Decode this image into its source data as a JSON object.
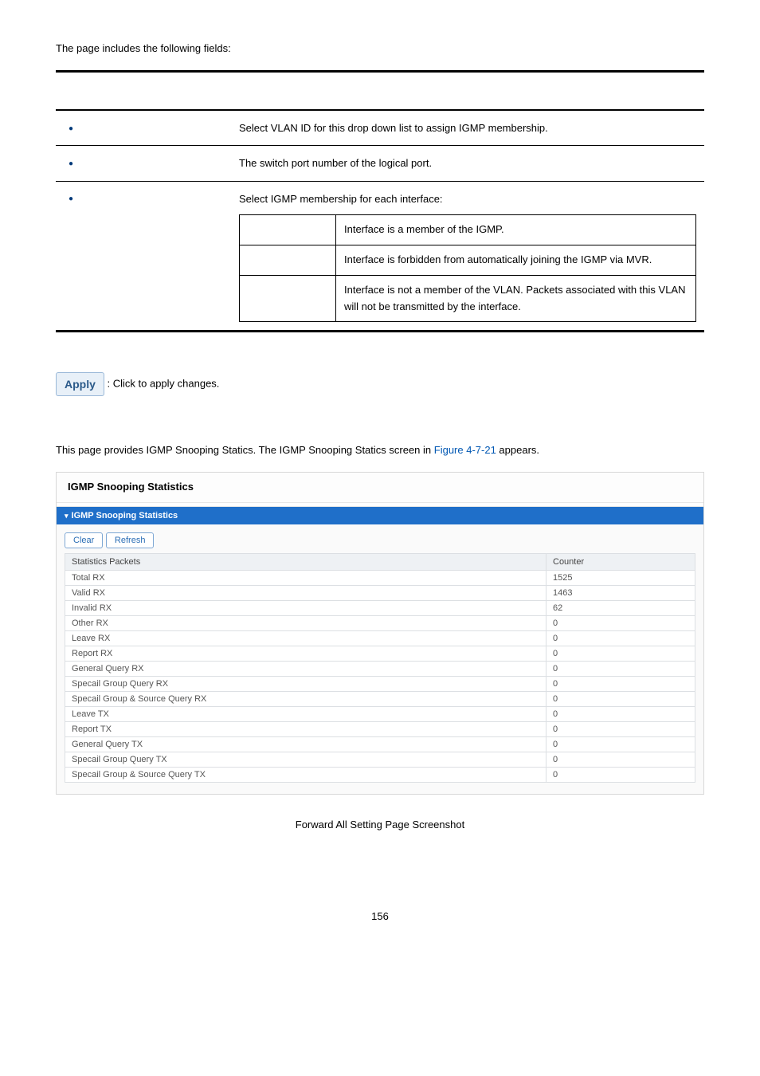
{
  "intro": "The page includes the following fields:",
  "field_table": {
    "header_obj": "",
    "header_desc": "",
    "rows": [
      {
        "obj": "",
        "desc": "Select VLAN ID for this drop down list to assign IGMP membership."
      },
      {
        "obj": "",
        "desc": "The switch port number of the logical port."
      },
      {
        "obj": "",
        "desc": "Select IGMP membership for each interface:"
      }
    ],
    "modes": [
      {
        "name": "",
        "desc": "Interface is a member of the IGMP."
      },
      {
        "name": "",
        "desc": "Interface is forbidden from automatically joining the IGMP via MVR."
      },
      {
        "name": "",
        "desc": "Interface is not a member of the VLAN. Packets associated with this VLAN will not be transmitted by the interface."
      }
    ]
  },
  "buttons": {
    "apply_label": "Apply",
    "apply_desc": ": Click to apply changes."
  },
  "section": {
    "desc_pre": "This page provides IGMP Snooping Statics. The IGMP Snooping Statics screen in ",
    "fig_ref": "Figure 4-7-21",
    "desc_post": " appears."
  },
  "panel": {
    "title": "IGMP Snooping Statistics",
    "sub_title": "IGMP Snooping Statistics",
    "clear": "Clear",
    "refresh": "Refresh",
    "col_packet": "Statistics Packets",
    "col_counter": "Counter",
    "rows": [
      {
        "name": "Total RX",
        "val": "1525"
      },
      {
        "name": "Valid RX",
        "val": "1463"
      },
      {
        "name": "Invalid RX",
        "val": "62"
      },
      {
        "name": "Other RX",
        "val": "0"
      },
      {
        "name": "Leave RX",
        "val": "0"
      },
      {
        "name": "Report RX",
        "val": "0"
      },
      {
        "name": "General Query RX",
        "val": "0"
      },
      {
        "name": "Specail Group Query RX",
        "val": "0"
      },
      {
        "name": "Specail Group & Source Query RX",
        "val": "0"
      },
      {
        "name": "Leave TX",
        "val": "0"
      },
      {
        "name": "Report TX",
        "val": "0"
      },
      {
        "name": "General Query TX",
        "val": "0"
      },
      {
        "name": "Specail Group Query TX",
        "val": "0"
      },
      {
        "name": "Specail Group & Source Query TX",
        "val": "0"
      }
    ]
  },
  "fig_caption": "Forward All Setting Page Screenshot",
  "page_num": "156"
}
